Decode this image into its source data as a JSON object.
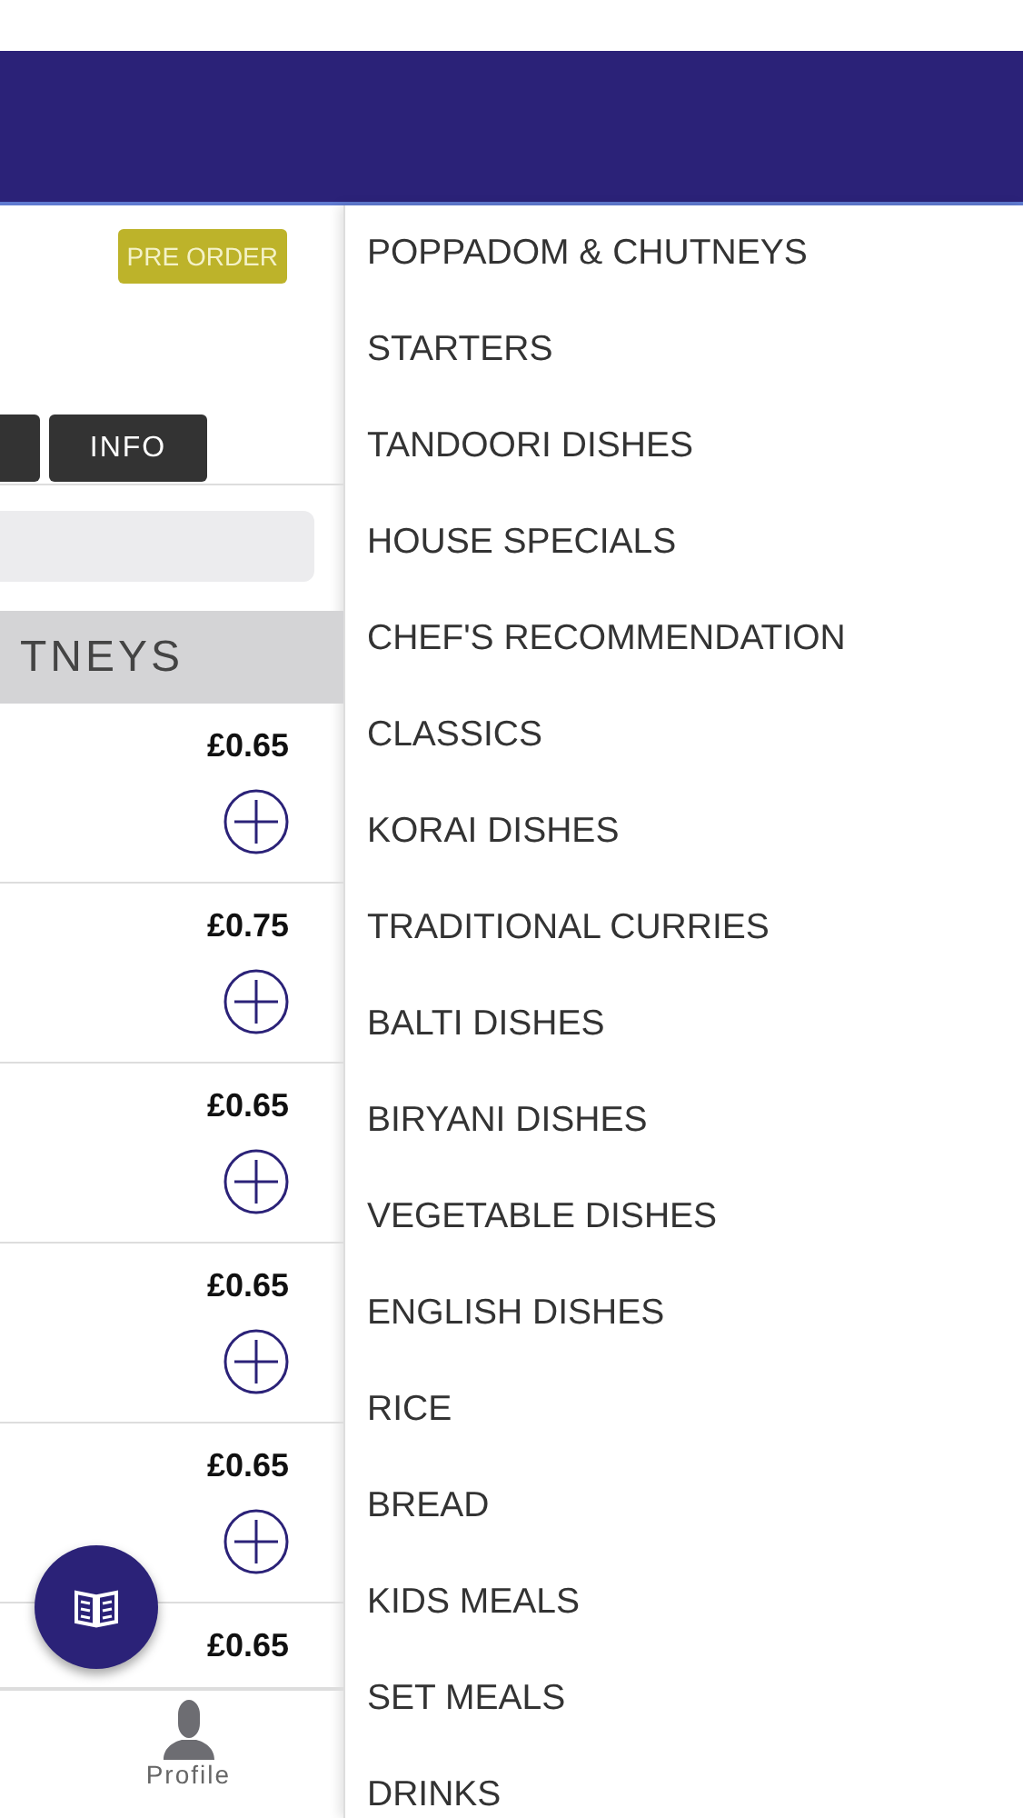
{
  "badge": "PRE ORDER",
  "buttons": [
    {
      "kind": "cut"
    },
    {
      "kind": "label",
      "label": "INFO"
    }
  ],
  "section_title": "TNEYS",
  "items": [
    {
      "price": "£0.65",
      "add": true
    },
    {
      "price": "£0.75",
      "add": true
    },
    {
      "price": "£0.65",
      "add": true
    },
    {
      "price": "£0.65",
      "add": true
    },
    {
      "price": "£0.65",
      "add": true
    },
    {
      "price": "£0.65",
      "add": false
    }
  ],
  "nav": {
    "label": "Profile"
  },
  "menu": [
    "POPPADOM & CHUTNEYS",
    "STARTERS",
    "TANDOORI DISHES",
    "HOUSE SPECIALS",
    "CHEF'S RECOMMENDATION",
    "CLASSICS",
    "KORAI DISHES",
    "TRADITIONAL CURRIES",
    "BALTI DISHES",
    "BIRYANI DISHES",
    "VEGETABLE DISHES",
    "ENGLISH DISHES",
    "RICE",
    "BREAD",
    "KIDS MEALS",
    "SET MEALS",
    "DRINKS"
  ]
}
